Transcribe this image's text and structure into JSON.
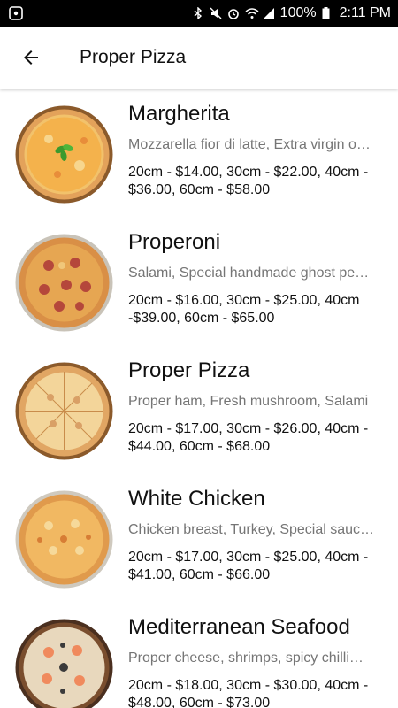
{
  "status": {
    "battery": "100%",
    "time": "2:11 PM"
  },
  "appbar": {
    "title": "Proper Pizza"
  },
  "items": [
    {
      "name": "Margherita",
      "description": "Mozzarella fior di latte, Extra virgin o…",
      "price": "20cm - $14.00, 30cm - $22.00, 40cm - $36.00, 60cm - $58.00"
    },
    {
      "name": "Properoni",
      "description": "Salami, Special handmade ghost pe…",
      "price": "20cm - $16.00, 30cm - $25.00, 40cm -$39.00, 60cm - $65.00"
    },
    {
      "name": "Proper Pizza",
      "description": "Proper ham, Fresh mushroom, Salami",
      "price": "20cm - $17.00, 30cm - $26.00, 40cm - $44.00,  60cm - $68.00"
    },
    {
      "name": "White Chicken",
      "description": "Chicken breast, Turkey, Special sauc…",
      "price": "20cm - $17.00, 30cm - $25.00, 40cm - $41.00, 60cm - $66.00"
    },
    {
      "name": "Mediterranean Seafood",
      "description": "Proper cheese, shrimps, spicy chilli…",
      "price": "20cm - $18.00, 30cm - $30.00, 40cm - $48.00, 60cm - $73.00"
    }
  ]
}
